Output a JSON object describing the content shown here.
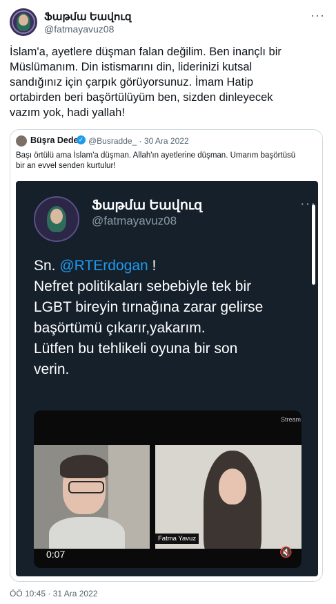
{
  "tweet": {
    "author_name": "Ֆաթմա Եավուզ",
    "author_handle": "@fatmayavuz08",
    "more_icon": "···",
    "text": "İslam'a, ayetlere düşman falan değilim. Ben inançlı bir\nMüslümanım. Din istismarını din, liderinizi kutsal\nsandığınız için çarpık görüyorsunuz. İmam Hatip\nortabirden beri başörtülüyüm ben, sizden dinleyecek\nvazım yok, hadi yallah!",
    "timestamp": "ÖÖ 10:45 · 31 Ara 2022"
  },
  "quoted": {
    "author_name": "Büşra Dede",
    "verified_icon": "✓",
    "meta": "@Busradde_ · 30 Ara 2022",
    "text": "Başı örtülü ama İslam'a düşman. Allah'ın ayetlerine düşman. Umarım başörtüsü\nbir an evvel senden kurtulur!"
  },
  "media": {
    "author_name": "Ֆաթմա Եավուզ",
    "author_handle": "@fatmayavuz08",
    "more_icon": "···",
    "text_prefix": "Sn. ",
    "mention": "@RTErdogan",
    "text_rest": " !\nNefret politikaları sebebiyle tek bir\nLGBT bireyin tırnağına zarar gelirse\nbaşörtümü çıkarır,yakarım.\nLütfen bu tehlikeli oyuna bir son\nverin.",
    "video": {
      "watermark": "Stream",
      "speaker_label": "Fatma Yavuz",
      "time": "0:07",
      "mute_icon": "🔇"
    }
  },
  "colors": {
    "accent": "#1d9bf0",
    "dark_bg": "#15202b",
    "muted_text": "#536471"
  }
}
